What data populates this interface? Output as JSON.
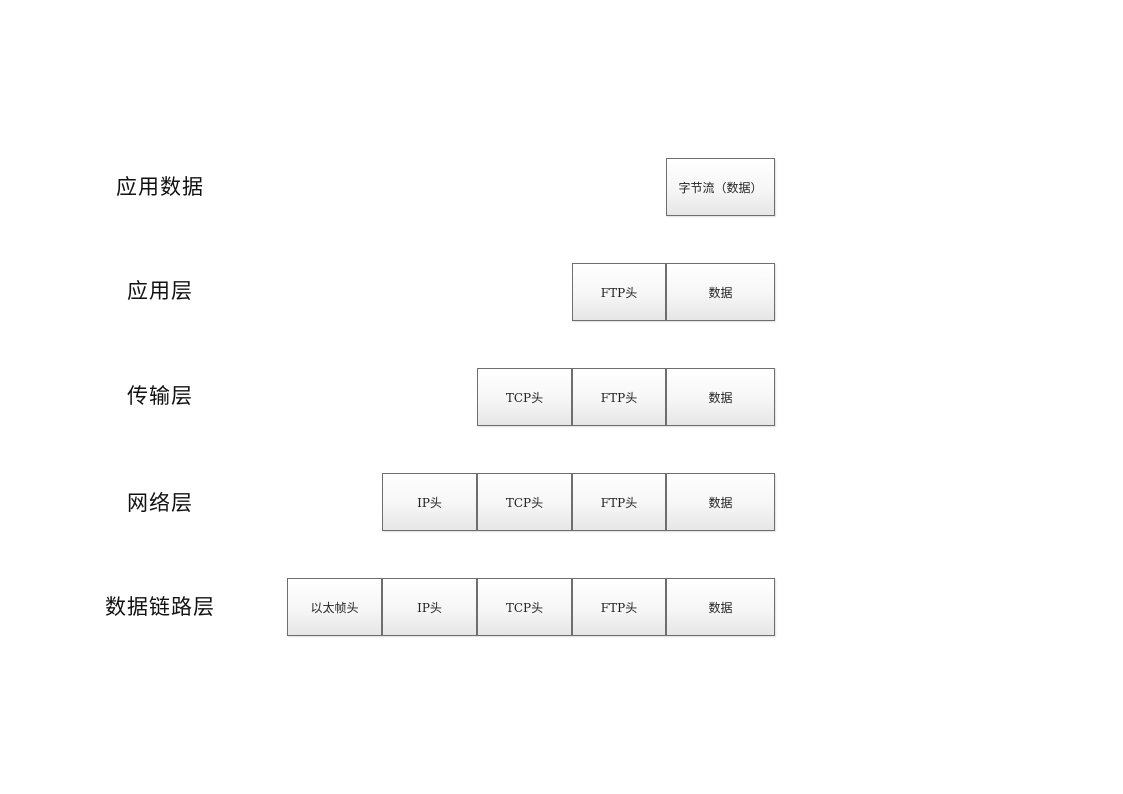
{
  "layers": [
    {
      "label": "应用数据",
      "cells": [
        "字节流（数据）"
      ]
    },
    {
      "label": "应用层",
      "cells": [
        "FTP头",
        "数据"
      ]
    },
    {
      "label": "传输层",
      "cells": [
        "TCP头",
        "FTP头",
        "数据"
      ]
    },
    {
      "label": "网络层",
      "cells": [
        "IP头",
        "TCP头",
        "FTP头",
        "数据"
      ]
    },
    {
      "label": "数据链路层",
      "cells": [
        "以太帧头",
        "IP头",
        "TCP头",
        "FTP头",
        "数据"
      ]
    }
  ]
}
